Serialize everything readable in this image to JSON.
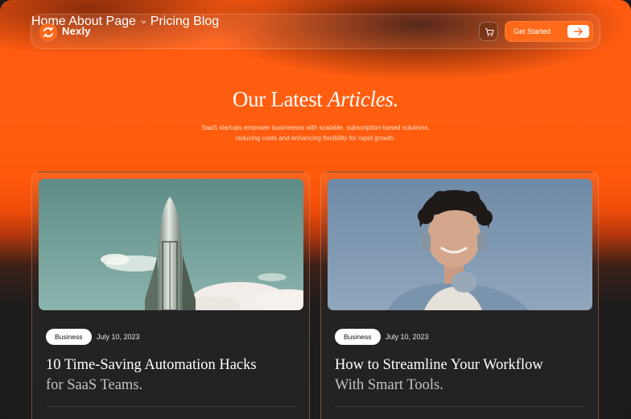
{
  "brand": {
    "name": "Nexly",
    "accent": "#ff6a1a"
  },
  "nav": {
    "items": [
      {
        "label": "Home",
        "active": true
      },
      {
        "label": "About"
      },
      {
        "label": "Page"
      },
      {
        "label": "Pricing"
      },
      {
        "label": "Blog"
      }
    ],
    "cart_icon": "cart-icon",
    "cta_label": "Get Started",
    "cta_icon": "arrow-right-icon"
  },
  "hero": {
    "title_plain": "Our Latest",
    "title_emphasis": "Articles.",
    "subtitle_line1": "SaaS startups empower businesses with scalable, subscription-based solutions,",
    "subtitle_line2": "reducing costs and enhancing flexibility for rapid growth."
  },
  "articles": [
    {
      "category": "Business",
      "date": "July 10, 2023",
      "title_line1": "10 Time-Saving Automation Hacks",
      "title_line2": "for SaaS Teams.",
      "image": "rocket-illustration"
    },
    {
      "category": "Business",
      "date": "July 10, 2023",
      "title_line1": "How to Streamline Your Workflow",
      "title_line2": "With Smart Tools.",
      "image": "person-with-headphones-photo"
    }
  ]
}
